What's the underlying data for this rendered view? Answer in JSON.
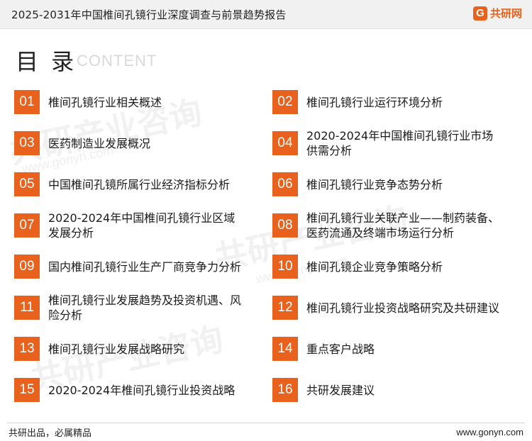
{
  "header": {
    "title": "2025-2031年中国椎间孔镜行业深度调查与前景趋势报告",
    "brand_icon": "G",
    "brand_name": "共研网",
    "accent_color": "#e8611d"
  },
  "heading": {
    "title": "目 录",
    "subtitle": "CONTENT"
  },
  "watermark": {
    "text": "共研产业咨询",
    "url": "www.gonyn.com"
  },
  "toc": [
    {
      "num": "01",
      "title": "椎间孔镜行业相关概述"
    },
    {
      "num": "02",
      "title": "椎间孔镜行业运行环境分析"
    },
    {
      "num": "03",
      "title": "医药制造业发展概况"
    },
    {
      "num": "04",
      "title": "2020-2024年中国椎间孔镜行业市场供需分析"
    },
    {
      "num": "05",
      "title": "中国椎间孔镜所属行业经济指标分析"
    },
    {
      "num": "06",
      "title": "椎间孔镜行业竞争态势分析"
    },
    {
      "num": "07",
      "title": "2020-2024年中国椎间孔镜行业区域发展分析"
    },
    {
      "num": "08",
      "title": "椎间孔镜行业关联产业——制药装备、医药流通及终端市场运行分析"
    },
    {
      "num": "09",
      "title": "国内椎间孔镜行业生产厂商竞争力分析"
    },
    {
      "num": "10",
      "title": "椎间孔镜企业竞争策略分析"
    },
    {
      "num": "11",
      "title": "椎间孔镜行业发展趋势及投资机遇、风险分析"
    },
    {
      "num": "12",
      "title": "椎间孔镜行业投资战略研究及共研建议"
    },
    {
      "num": "13",
      "title": "椎间孔镜行业发展战略研究"
    },
    {
      "num": "14",
      "title": "重点客户战略"
    },
    {
      "num": "15",
      "title": "2020-2024年椎间孔镜行业投资战略"
    },
    {
      "num": "16",
      "title": "共研发展建议"
    }
  ],
  "footer": {
    "left": "共研出品，必属精品",
    "right": "www.gonyn.com"
  }
}
